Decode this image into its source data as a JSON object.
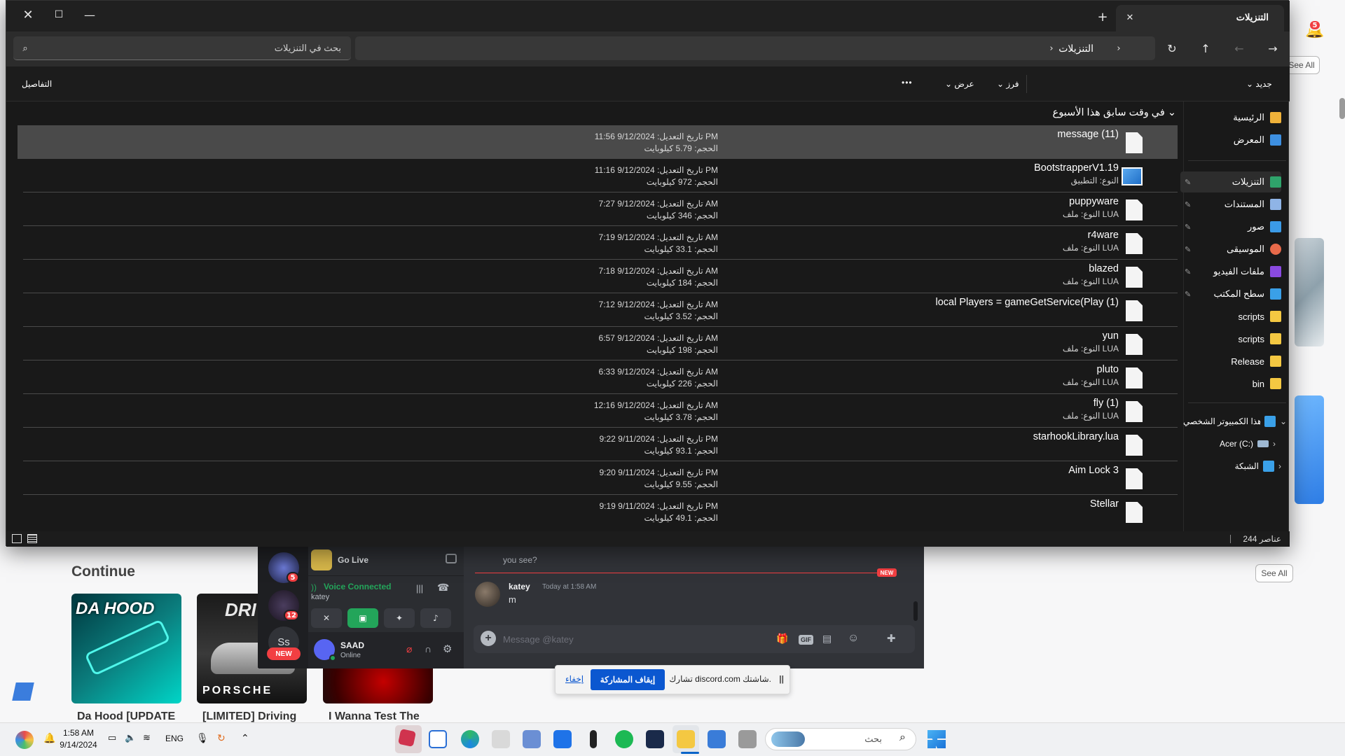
{
  "explorer": {
    "tab_title": "التنزيلات",
    "breadcrumb": [
      "التنزيلات"
    ],
    "search_placeholder": "بحث في التنزيلات",
    "cmd": {
      "new": "جديد",
      "sort": "فرز",
      "view": "عرض",
      "more": "•••",
      "details": "التفاصيل"
    },
    "group_header": "في وقت سابق هذا الأسبوع",
    "date_prefix": "تاريخ التعديل:",
    "size_prefix": "الحجم:",
    "type_prefix": "النوع:",
    "files": [
      {
        "name": "message (11)",
        "type": "",
        "date": "9/12/2024 11:56 PM",
        "size": "5.79 كيلوبايت",
        "selected": true,
        "icon": "text-file-icon"
      },
      {
        "name": "BootstrapperV1.19",
        "type": "النوع: التطبيق",
        "date": "9/12/2024 11:16 PM",
        "size": "972 كيلوبايت",
        "selected": false,
        "icon": "app-icon"
      },
      {
        "name": "puppyware",
        "type": "النوع: ملف LUA",
        "date": "9/12/2024 7:27 AM",
        "size": "346 كيلوبايت",
        "selected": false,
        "icon": "text-file-icon"
      },
      {
        "name": "r4ware",
        "type": "النوع: ملف LUA",
        "date": "9/12/2024 7:19 AM",
        "size": "33.1 كيلوبايت",
        "selected": false,
        "icon": "text-file-icon"
      },
      {
        "name": "blazed",
        "type": "النوع: ملف LUA",
        "date": "9/12/2024 7:18 AM",
        "size": "184 كيلوبايت",
        "selected": false,
        "icon": "text-file-icon"
      },
      {
        "name": "local Players = gameGetService(Play (1)",
        "type": "",
        "date": "9/12/2024 7:12 AM",
        "size": "3.52 كيلوبايت",
        "selected": false,
        "icon": "text-file-icon"
      },
      {
        "name": "yun",
        "type": "النوع: ملف LUA",
        "date": "9/12/2024 6:57 AM",
        "size": "198 كيلوبايت",
        "selected": false,
        "icon": "text-file-icon"
      },
      {
        "name": "pluto",
        "type": "النوع: ملف LUA",
        "date": "9/12/2024 6:33 AM",
        "size": "226 كيلوبايت",
        "selected": false,
        "icon": "text-file-icon"
      },
      {
        "name": "fly (1)",
        "type": "النوع: ملف LUA",
        "date": "9/12/2024 12:16 AM",
        "size": "3.78 كيلوبايت",
        "selected": false,
        "icon": "text-file-icon"
      },
      {
        "name": "starhookLibrary.lua",
        "type": "",
        "date": "9/11/2024 9:22 PM",
        "size": "93.1 كيلوبايت",
        "selected": false,
        "icon": "text-file-icon"
      },
      {
        "name": "Aim Lock 3",
        "type": "",
        "date": "9/11/2024 9:20 PM",
        "size": "9.55 كيلوبايت",
        "selected": false,
        "icon": "text-file-icon"
      },
      {
        "name": "Stellar",
        "type": "",
        "date": "9/11/2024 9:19 PM",
        "size": "49.1 كيلوبايت",
        "selected": false,
        "icon": "text-file-icon"
      }
    ],
    "nav": [
      {
        "label": "الرئيسية",
        "icon": "home-icon",
        "color": "#f0b23a",
        "pinned": false
      },
      {
        "label": "المعرض",
        "icon": "gallery-icon",
        "color": "#3d8fe0",
        "pinned": false
      },
      {
        "label": "التنزيلات",
        "icon": "downloads-icon",
        "color": "#2fa36b",
        "pinned": true
      },
      {
        "label": "المستندات",
        "icon": "documents-icon",
        "color": "#8fb4e6",
        "pinned": true
      },
      {
        "label": "صور",
        "icon": "pictures-icon",
        "color": "#3b9be8",
        "pinned": true
      },
      {
        "label": "الموسيقى",
        "icon": "music-icon",
        "color": "#e86a4a",
        "pinned": true
      },
      {
        "label": "ملفات الفيديو",
        "icon": "videos-icon",
        "color": "#8a4ae0",
        "pinned": true
      },
      {
        "label": "سطح المكتب",
        "icon": "desktop-icon",
        "color": "#3aa0e8",
        "pinned": true
      },
      {
        "label": "scripts",
        "icon": "folder-icon",
        "color": "#f4c842",
        "pinned": false
      },
      {
        "label": "scripts",
        "icon": "folder-icon",
        "color": "#f4c842",
        "pinned": false
      },
      {
        "label": "Release",
        "icon": "folder-icon",
        "color": "#f4c842",
        "pinned": false
      },
      {
        "label": "bin",
        "icon": "folder-icon",
        "color": "#f4c842",
        "pinned": false
      }
    ],
    "nav_pc": "هذا الكمبيوتر الشخصي",
    "nav_drive": "Acer (C:)",
    "nav_network": "الشبكة",
    "status_count": "244 عناصر"
  },
  "roblox": {
    "continue_label": "Continue",
    "see_all": "See All",
    "games": [
      {
        "title": "Da Hood [UPDATE",
        "thumb_text": "DA HOOD"
      },
      {
        "title": "[LIMITED] Driving",
        "thumb_text": "PORSCHE"
      },
      {
        "title": "I Wanna Test The",
        "thumb_text": ""
      }
    ],
    "notification_count": "5"
  },
  "discord": {
    "server_badge_1": "5",
    "server_badge_2": "12",
    "server_initials": "Ss",
    "new_badge": "NEW",
    "go_live": "Go Live",
    "voice_connected": "Voice Connected",
    "voice_channel": "katey",
    "username": "SAAD",
    "user_status": "Online",
    "prev_message": "you see?",
    "new_divider": "NEW",
    "msg_author": "katey",
    "msg_time": "Today at 1:58 AM",
    "msg_text": "m",
    "input_placeholder": "Message @katey",
    "gif_label": "GIF"
  },
  "sharebar": {
    "text": "تشارك discord.com شاشتك.",
    "stop_button": "إيقاف المشاركة",
    "hide_link": "إخفاء"
  },
  "taskbar": {
    "time": "1:58 AM",
    "date": "9/14/2024",
    "language": "ENG",
    "search_placeholder": "بحث"
  }
}
